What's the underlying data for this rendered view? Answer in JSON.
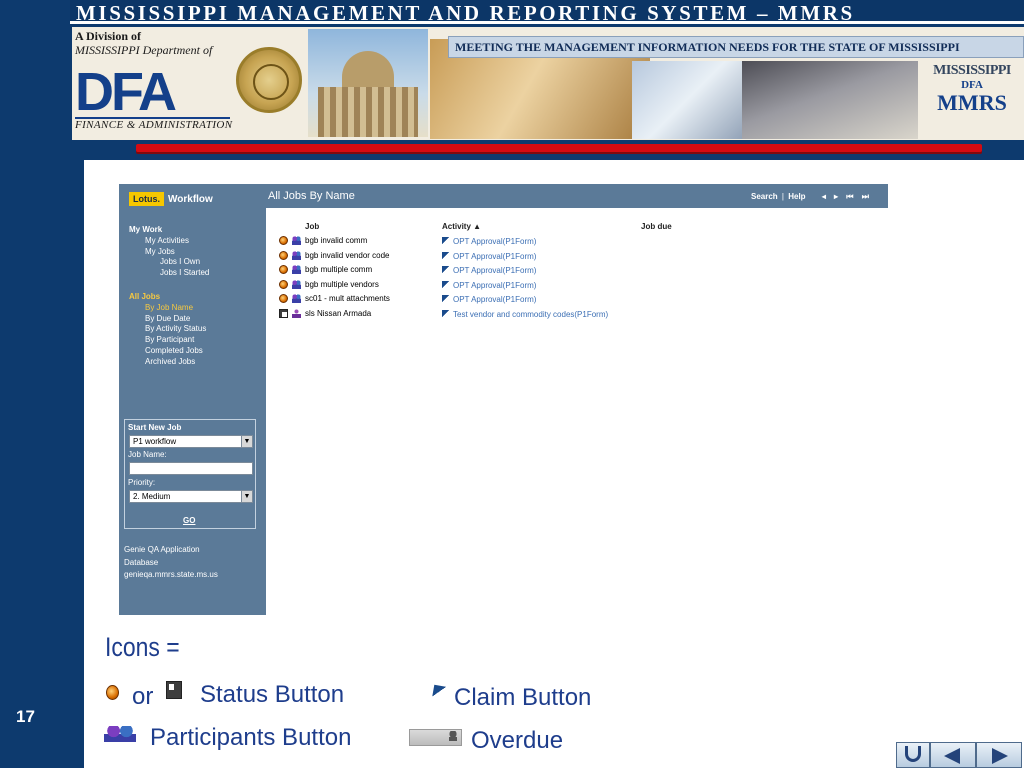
{
  "header": {
    "title": "MISSISSIPPI MANAGEMENT AND REPORTING SYSTEM – MMRS",
    "division": "A Division of",
    "department": "MISSISSIPPI Department of",
    "dfa_logo": "DFA",
    "dfa_subtitle": "FINANCE & ADMINISTRATION",
    "tagline": "MEETING THE MANAGEMENT INFORMATION NEEDS FOR THE STATE OF MISSISSIPPI",
    "mmrs_logo": {
      "state": "MISSISSIPPI",
      "dfa": "DFA",
      "name": "MMRS"
    },
    "accent_color": "#d30b12"
  },
  "app": {
    "brand": {
      "badge": "Lotus.",
      "name": "Workflow"
    },
    "page_heading": "All Jobs By Name",
    "topnav": {
      "search": "Search",
      "separator": "|",
      "help": "Help",
      "pager": "◂ ▸ ⏮ ⏭"
    },
    "sidebar": {
      "my_work": "My Work",
      "my_activities": "My Activities",
      "my_jobs": "My Jobs",
      "jobs_i_own": "Jobs I Own",
      "jobs_i_started": "Jobs I Started",
      "all_jobs": "All Jobs",
      "by_job_name": "By Job Name",
      "by_due_date": "By Due Date",
      "by_activity_status": "By Activity Status",
      "by_participant": "By Participant",
      "completed_jobs": "Completed Jobs",
      "archived_jobs": "Archived Jobs"
    },
    "start_new_job": {
      "title": "Start New Job",
      "workflow_value": "P1 workflow",
      "job_name_label": "Job Name:",
      "job_name_value": "",
      "priority_label": "Priority:",
      "priority_value": "2. Medium",
      "go": "GO"
    },
    "db_info": {
      "line1": "Genie QA Application",
      "line2": "Database",
      "line3": "genieqa.mmrs.state.ms.us"
    },
    "columns": {
      "job": "Job",
      "activity": "Activity ▲",
      "job_due": "Job due"
    },
    "jobs": [
      {
        "status_icon": "status-round-icon",
        "job": "bgb invalid comm",
        "activity": "OPT Approval(P1Form)"
      },
      {
        "status_icon": "status-round-icon",
        "job": "bgb invalid vendor code",
        "activity": "OPT Approval(P1Form)"
      },
      {
        "status_icon": "status-round-icon",
        "job": "bgb multiple comm",
        "activity": "OPT Approval(P1Form)"
      },
      {
        "status_icon": "status-round-icon",
        "job": "bgb multiple vendors",
        "activity": "OPT Approval(P1Form)"
      },
      {
        "status_icon": "status-round-icon",
        "job": "sc01 - mult attachments",
        "activity": "OPT Approval(P1Form)"
      },
      {
        "status_icon": "status-doc-icon",
        "job": "sls Nissan Armada",
        "activity": "Test vendor and commodity codes(P1Form)"
      }
    ]
  },
  "legend": {
    "title": "Icons =",
    "or": "or",
    "status_button": "Status Button",
    "claim_button": "Claim Button",
    "participants_button": "Participants Button",
    "overdue": "Overdue"
  },
  "footer": {
    "slide_number": "17"
  },
  "colors": {
    "slide_bg": "#0d3a6e",
    "sidebar": "#5b7a98",
    "link": "#3c6fb4",
    "legend_text": "#1e3d8c"
  }
}
